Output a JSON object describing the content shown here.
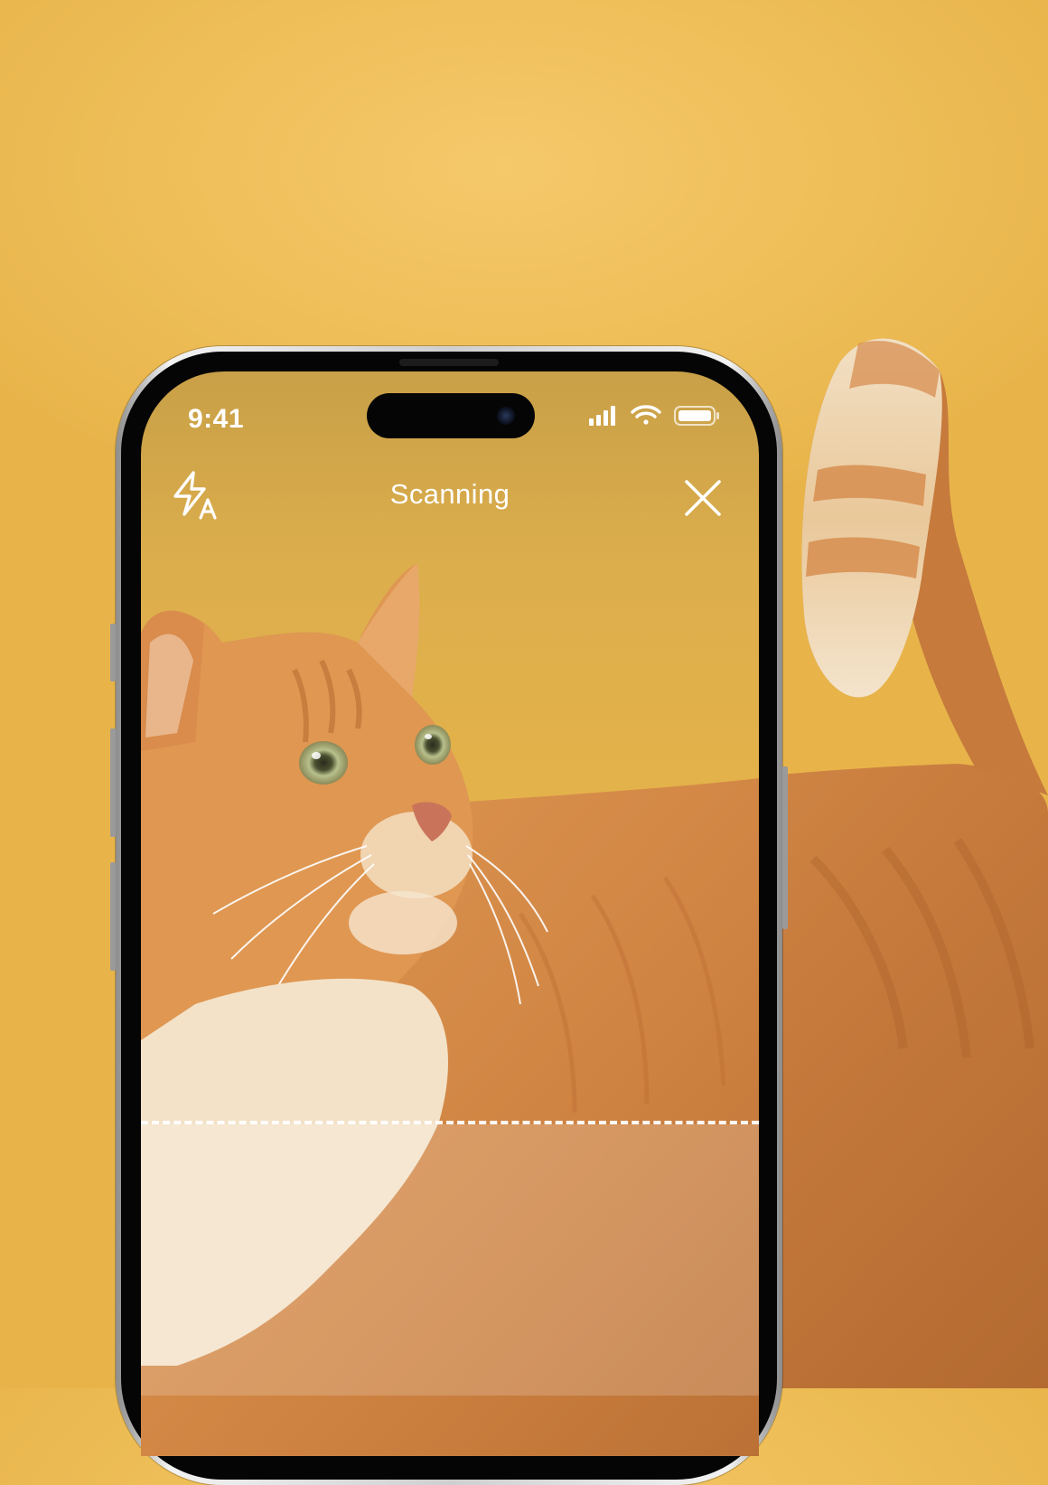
{
  "status_bar": {
    "time": "9:41"
  },
  "header": {
    "title": "Scanning",
    "flash_icon": "flash-auto-icon",
    "close_icon": "close-icon"
  },
  "theme": {
    "background": "#ebb955",
    "text": "#ffffff",
    "scan_line": "#ffffff"
  }
}
